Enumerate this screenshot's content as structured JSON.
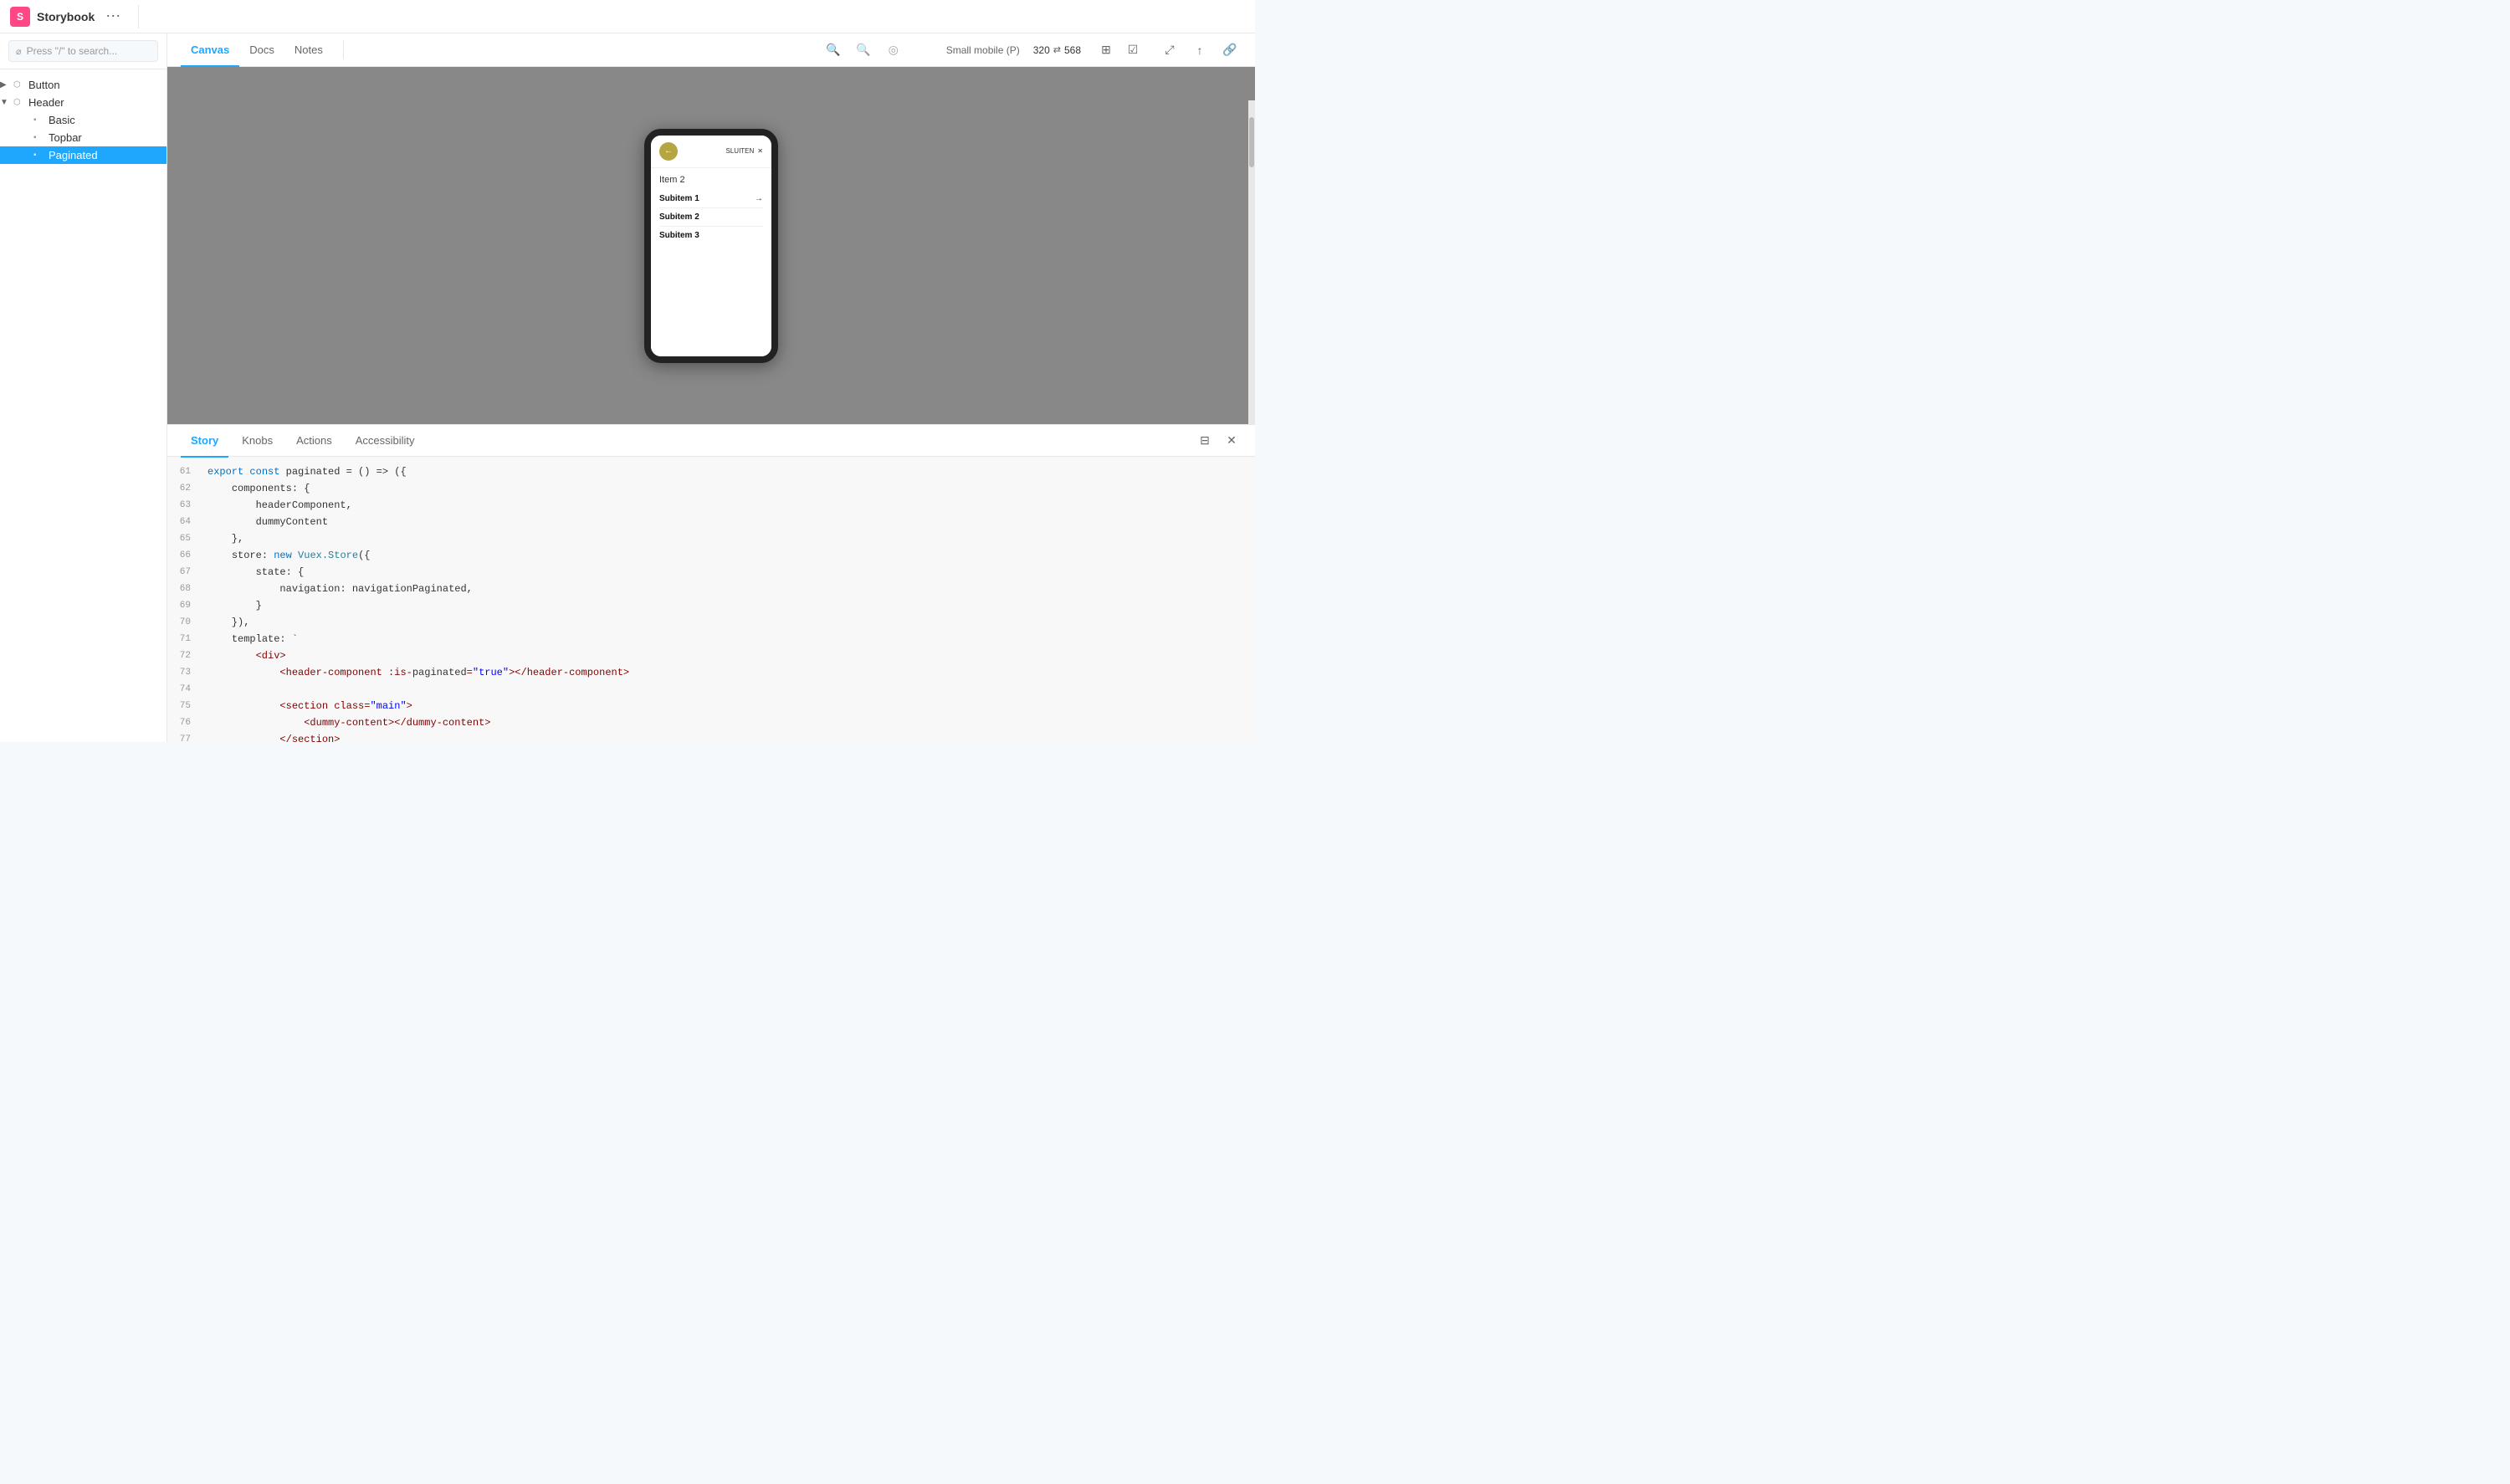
{
  "app": {
    "title": "Storybook",
    "logo_text": "Storybook"
  },
  "toolbar": {
    "tabs": [
      "Canvas",
      "Docs",
      "Notes"
    ],
    "active_tab": "Canvas",
    "viewport_label": "Small mobile (P)",
    "width": "320",
    "height": "568",
    "menu_dots": "⋯"
  },
  "sidebar": {
    "search_placeholder": "Press \"/\" to search...",
    "items": [
      {
        "label": "Button",
        "level": "root",
        "type": "group",
        "expanded": false
      },
      {
        "label": "Header",
        "level": "root",
        "type": "group",
        "expanded": true
      },
      {
        "label": "Basic",
        "level": "child",
        "type": "story"
      },
      {
        "label": "Topbar",
        "level": "child",
        "type": "story"
      },
      {
        "label": "Paginated",
        "level": "child",
        "type": "story",
        "active": true
      }
    ]
  },
  "phone": {
    "header": {
      "back_label": "←",
      "close_label": "SLUITEN",
      "close_icon": "✕"
    },
    "item_label": "Item 2",
    "subitems": [
      {
        "label": "Subitem 1",
        "has_arrow": true
      },
      {
        "label": "Subitem 2",
        "has_arrow": false
      },
      {
        "label": "Subitem 3",
        "has_arrow": false
      }
    ]
  },
  "bottom_panel": {
    "tabs": [
      "Story",
      "Knobs",
      "Actions",
      "Accessibility"
    ],
    "active_tab": "Story"
  },
  "code": {
    "lines": [
      {
        "num": "61",
        "content": "export const paginated = () => ({"
      },
      {
        "num": "62",
        "content": "    components: {"
      },
      {
        "num": "63",
        "content": "        headerComponent,"
      },
      {
        "num": "64",
        "content": "        dummyContent"
      },
      {
        "num": "65",
        "content": "    },"
      },
      {
        "num": "66",
        "content": "    store: new Vuex.Store({"
      },
      {
        "num": "67",
        "content": "        state: {"
      },
      {
        "num": "68",
        "content": "            navigation: navigationPaginated,"
      },
      {
        "num": "69",
        "content": "        }"
      },
      {
        "num": "70",
        "content": "    }),"
      },
      {
        "num": "71",
        "content": "    template: `"
      },
      {
        "num": "72",
        "content": "        <div>"
      },
      {
        "num": "73",
        "content": "            <header-component :is-paginated=\"true\"></header-component>"
      },
      {
        "num": "74",
        "content": ""
      },
      {
        "num": "75",
        "content": "            <section class=\"main\">"
      },
      {
        "num": "76",
        "content": "                <dummy-content></dummy-content>"
      },
      {
        "num": "77",
        "content": "            </section>"
      }
    ]
  }
}
